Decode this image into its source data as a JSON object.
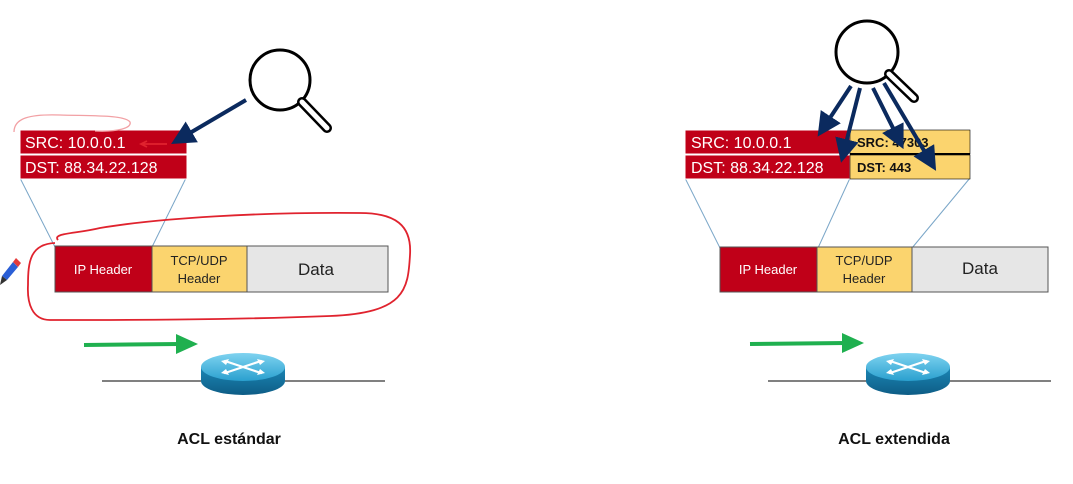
{
  "colors": {
    "ip_header": "#c00018",
    "tcp_header": "#fbd46e",
    "data_box": "#e6e6e6",
    "arrow_navy": "#0b2a5e",
    "arrow_green": "#1fb04f",
    "annotation_red": "#e0232e",
    "router": "#2aa0cf"
  },
  "icons": [
    "magnifier-icon",
    "router-icon",
    "pen-icon",
    "flow-arrow"
  ],
  "standard": {
    "src_label": "SRC: 10.0.0.1",
    "dst_label": "DST: 88.34.22.128",
    "ip_header": "IP Header",
    "tcp_header_line1": "TCP/UDP",
    "tcp_header_line2": "Header",
    "data": "Data",
    "caption": "ACL estándar"
  },
  "extended": {
    "src_label": "SRC: 10.0.0.1",
    "dst_label": "DST: 88.34.22.128",
    "src_port": "SRC: 47303",
    "dst_port": "DST: 443",
    "ip_header": "IP Header",
    "tcp_header_line1": "TCP/UDP",
    "tcp_header_line2": "Header",
    "data": "Data",
    "caption": "ACL extendida"
  }
}
